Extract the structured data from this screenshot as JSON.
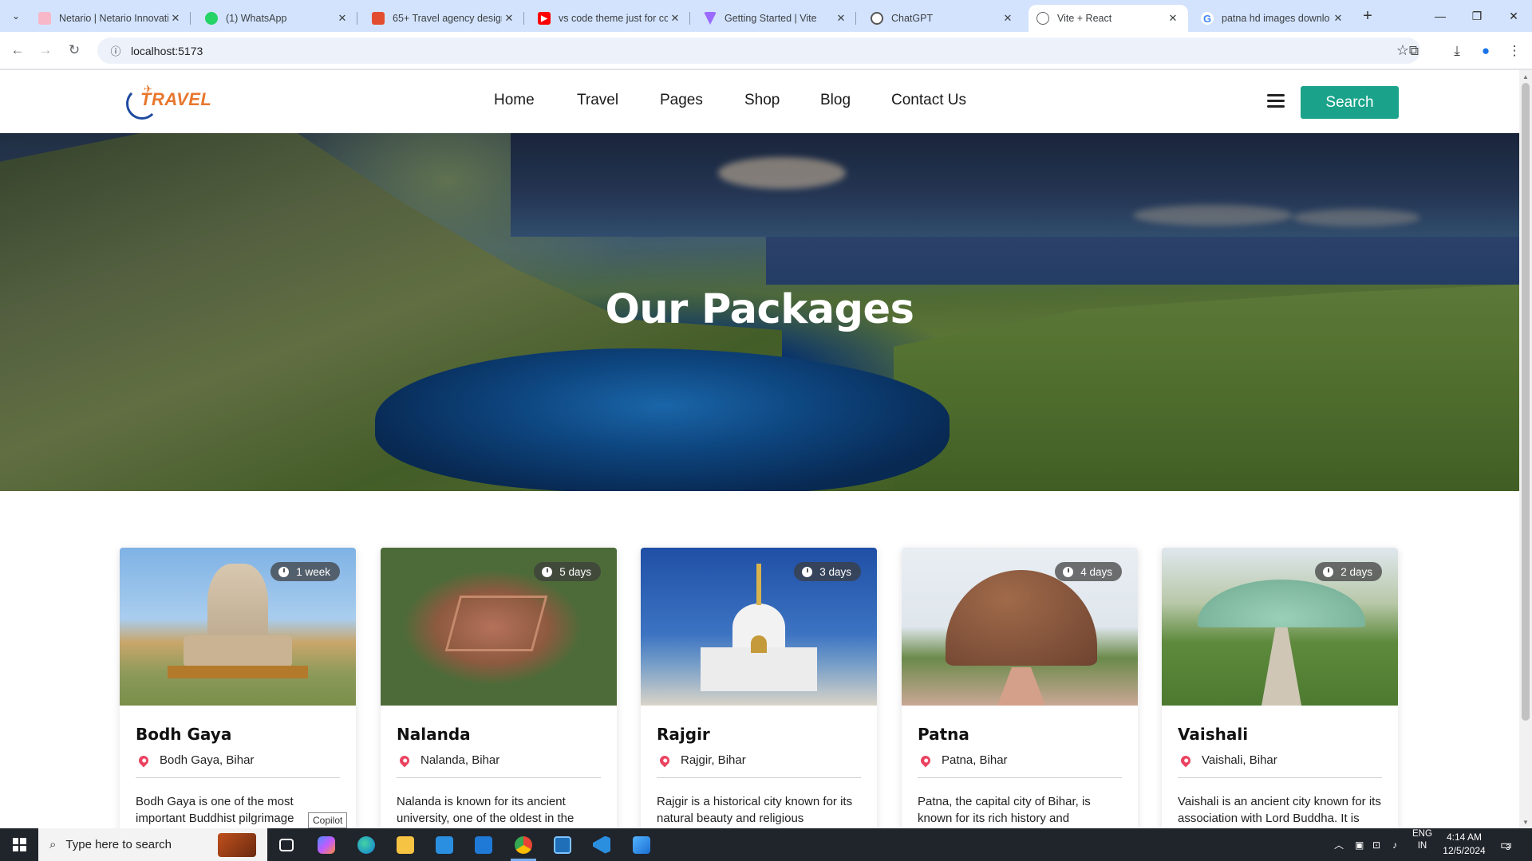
{
  "browser": {
    "tabs": [
      {
        "title": "Netario | Netario Innovati",
        "fav_color": "#f7b7c8",
        "active": false
      },
      {
        "title": "(1) WhatsApp",
        "fav_color": "#25d366",
        "active": false
      },
      {
        "title": "65+ Travel agency design",
        "fav_color": "#e34d2f",
        "active": false
      },
      {
        "title": "vs code theme just for co",
        "fav_color": "#ff0000",
        "active": false
      },
      {
        "title": "Getting Started | Vite",
        "fav_color": "#9b6bff",
        "active": false
      },
      {
        "title": "ChatGPT",
        "fav_color": "#555555",
        "active": false
      },
      {
        "title": "Vite + React",
        "fav_color": "#5f6368",
        "active": true
      },
      {
        "title": "patna hd images downlo",
        "fav_color": "#4285f4",
        "active": false
      }
    ],
    "url": "localhost:5173"
  },
  "site": {
    "logo_text": "TRAVEL",
    "nav": [
      "Home",
      "Travel",
      "Pages",
      "Shop",
      "Blog",
      "Contact Us"
    ],
    "search_label": "Search",
    "hero_title": "Our Packages",
    "packages": [
      {
        "name": "Bodh Gaya",
        "location": "Bodh Gaya, Bihar",
        "duration": "1 week",
        "description": "Bodh Gaya is one of the most important Buddhist pilgrimage"
      },
      {
        "name": "Nalanda",
        "location": "Nalanda, Bihar",
        "duration": "5 days",
        "description": "Nalanda is known for its ancient university, one of the oldest in the"
      },
      {
        "name": "Rajgir",
        "location": "Rajgir, Bihar",
        "duration": "3 days",
        "description": "Rajgir is a historical city known for its natural beauty and religious"
      },
      {
        "name": "Patna",
        "location": "Patna, Bihar",
        "duration": "4 days",
        "description": "Patna, the capital city of Bihar, is known for its rich history and"
      },
      {
        "name": "Vaishali",
        "location": "Vaishali, Bihar",
        "duration": "2 days",
        "description": "Vaishali is an ancient city known for its association with Lord Buddha. It is"
      }
    ],
    "tooltip": "Copilot"
  },
  "taskbar": {
    "search_placeholder": "Type here to search",
    "lang_line1": "ENG",
    "lang_line2": "IN",
    "time": "4:14 AM",
    "date": "12/5/2024",
    "notifications": "3"
  },
  "colors": {
    "accent": "#1aa38a",
    "pin": "#ea4360"
  }
}
